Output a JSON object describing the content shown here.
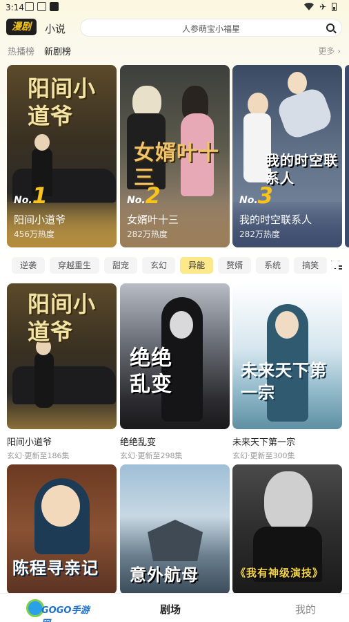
{
  "status_bar": {
    "time": "3:14"
  },
  "header": {
    "logo": "漫剧",
    "novel_tab": "小说",
    "search_placeholder": "人参萌宝小福星"
  },
  "rank_section": {
    "tabs": [
      {
        "label": "热播榜",
        "active": false
      },
      {
        "label": "新剧榜",
        "active": true
      }
    ],
    "more": "更多 ›",
    "items": [
      {
        "rank_prefix": "No.",
        "rank": "1",
        "title": "阳间小道爷",
        "heat": "456万热度",
        "cover_text": "阳间小道爷"
      },
      {
        "rank_prefix": "No.",
        "rank": "2",
        "title": "女婿叶十三",
        "heat": "282万热度",
        "cover_text": "女婿叶十三"
      },
      {
        "rank_prefix": "No.",
        "rank": "3",
        "title": "我的时空联系人",
        "heat": "282万热度",
        "cover_text": "我的时空联系人"
      }
    ]
  },
  "genres": {
    "items": [
      "逆袭",
      "穿越重生",
      "甜宠",
      "玄幻",
      "异能",
      "赘婿",
      "系统",
      "搞笑"
    ],
    "active": "异能"
  },
  "grid": [
    {
      "title": "阳间小道爷",
      "meta": "玄幻·更新至186集",
      "cover_text": "阳间小道爷"
    },
    {
      "title": "绝绝乱变",
      "meta": "玄幻·更新至298集",
      "cover_text": "绝绝乱变"
    },
    {
      "title": "未来天下第一宗",
      "meta": "玄幻·更新至300集",
      "cover_text": "未来天下第一宗"
    },
    {
      "title": "",
      "meta": "",
      "cover_text": "陈程寻亲记"
    },
    {
      "title": "",
      "meta": "",
      "cover_text": "意外航母"
    },
    {
      "title": "",
      "meta": "",
      "cover_text": "《我有神级演技》"
    }
  ],
  "bottom_nav": {
    "home": "剧场",
    "mine": "我的"
  },
  "watermark": "GOGO手游网",
  "colors": {
    "accent": "#fde88a",
    "rank_number": "#f7c31c"
  }
}
